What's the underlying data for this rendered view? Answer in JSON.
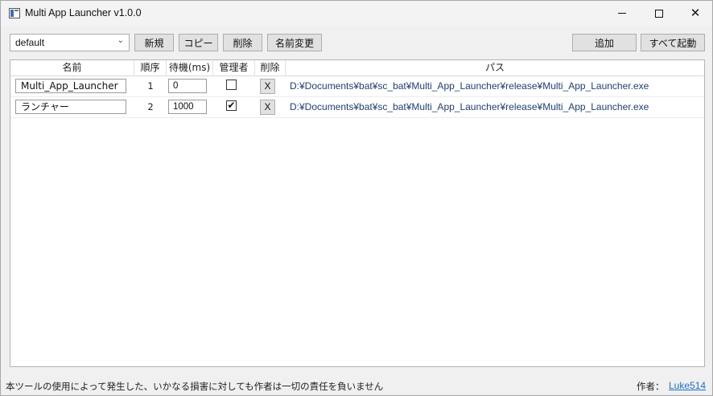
{
  "window": {
    "title": "Multi App Launcher v1.0.0"
  },
  "toolbar": {
    "profile_selected": "default",
    "new_label": "新規",
    "copy_label": "コピー",
    "delete_label": "削除",
    "rename_label": "名前変更",
    "add_label": "追加",
    "launch_all_label": "すべて起動"
  },
  "table": {
    "headers": {
      "name": "名前",
      "order": "順序",
      "wait": "待機(ms)",
      "admin": "管理者",
      "delete": "削除",
      "path": "パス"
    },
    "rows": [
      {
        "name": "Multi_App_Launcher",
        "order": "1",
        "wait": "0",
        "admin": false,
        "delete_label": "X",
        "path": "D:¥Documents¥bat¥sc_bat¥Multi_App_Launcher¥release¥Multi_App_Launcher.exe"
      },
      {
        "name": "ランチャー",
        "order": "2",
        "wait": "1000",
        "admin": true,
        "delete_label": "X",
        "path": "D:¥Documents¥bat¥sc_bat¥Multi_App_Launcher¥release¥Multi_App_Launcher.exe"
      }
    ]
  },
  "status": {
    "disclaimer": "本ツールの使用によって発生した、いかなる損害に対しても作者は一切の責任を負いません",
    "author_label": "作者：",
    "author_name": "Luke514"
  },
  "colors": {
    "path_text": "#1f3f75",
    "link": "#1a6fd0"
  },
  "icons": {
    "app": "app-window-icon",
    "minimize": "minimize-icon",
    "maximize": "maximize-icon",
    "close": "close-icon",
    "dropdown": "chevron-down-icon",
    "checked": "checkmark-icon"
  }
}
